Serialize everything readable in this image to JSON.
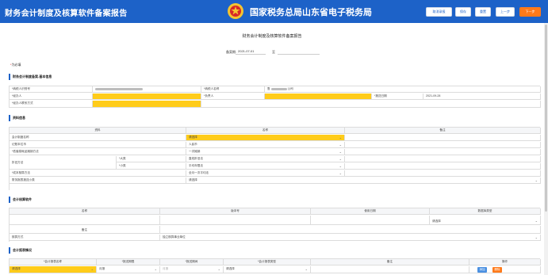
{
  "header": {
    "app_title": "财务会计制度及核算软件备案报告",
    "bureau_title": "国家税务总局山东省电子税务局",
    "buttons": [
      "取消录报",
      "保存",
      "重置",
      "上一步",
      "下一步"
    ]
  },
  "document": {
    "title": "财务会计制度及核算软件备案报告",
    "period_label": "备案期:",
    "period_start": "2021-07-01",
    "period_sep": "至",
    "required_note_star": "*",
    "required_note_text": "为必填"
  },
  "section_basic": {
    "title": "财务会计制度备案-基本信息",
    "taxpayer_id_label": "*纳税人识别号",
    "taxpayer_name_label": "*纳税人名称",
    "taxpayer_name_prefix": "鲁",
    "taxpayer_name_suffix": "公司",
    "agent_label": "*经办人",
    "responsible_label": "*负责人",
    "report_date_label": "*报送日期",
    "report_date_value": "2021-09-28",
    "contact_label": "*经办人联系方式"
  },
  "section_policy": {
    "title": "资料信息",
    "headers": [
      "资料",
      "名称",
      "备注"
    ],
    "rows": [
      {
        "label": "会计制度名称",
        "value": "请选择",
        "highlight": true,
        "sub": ""
      },
      {
        "label": "记账本位币",
        "value": "人民币",
        "highlight": false,
        "sub": ""
      },
      {
        "label": "*低值易耗品摊销方法",
        "value": "一次摊销",
        "highlight": false,
        "sub": ""
      },
      {
        "label": "折旧方法",
        "value": "直线折旧法",
        "highlight": false,
        "sub": "*大类"
      },
      {
        "label": "",
        "value": "平均年限法",
        "highlight": false,
        "sub": "*小类"
      },
      {
        "label": "*成本核算方法",
        "value": "全月一次平均法",
        "highlight": false,
        "sub": ""
      },
      {
        "label": "財务报表报送小类",
        "value": "请选择",
        "highlight": false,
        "sub": ""
      }
    ]
  },
  "section_software": {
    "title": "会计核算软件",
    "headers": [
      "名称",
      "版本号",
      "使用日期",
      "数据库类型"
    ],
    "db_value": "请选择",
    "remark_label": "备注",
    "method_label": "核算方式",
    "method_value": "独立核算事业单位"
  },
  "section_report": {
    "title": "会计报表情况",
    "headers": [
      "*会计报表名称",
      "*报送期限",
      "*报送期间",
      "*会计报表类型",
      "备注",
      "操作"
    ],
    "row": [
      "请选择",
      "月报",
      "月报",
      "请选择"
    ],
    "action_labels": [
      "添加",
      "删除"
    ]
  },
  "colors": {
    "header_blue": "#1d62c8",
    "required_yellow": "#ffcc1a",
    "accent_orange": "#ff7a1a"
  }
}
